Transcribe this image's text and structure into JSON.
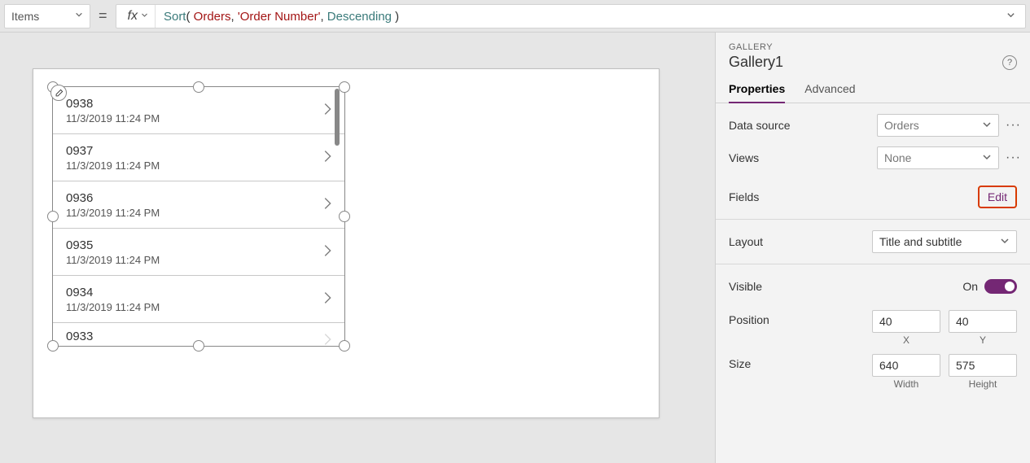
{
  "formulaBar": {
    "property": "Items",
    "fxLabel": "fx",
    "formula": {
      "fn": "Sort",
      "arg1": "Orders",
      "arg2": "'Order Number'",
      "arg3": "Descending"
    }
  },
  "gallery": {
    "items": [
      {
        "title": "0938",
        "subtitle": "11/3/2019 11:24 PM"
      },
      {
        "title": "0937",
        "subtitle": "11/3/2019 11:24 PM"
      },
      {
        "title": "0936",
        "subtitle": "11/3/2019 11:24 PM"
      },
      {
        "title": "0935",
        "subtitle": "11/3/2019 11:24 PM"
      },
      {
        "title": "0934",
        "subtitle": "11/3/2019 11:24 PM"
      },
      {
        "title": "0933",
        "subtitle": ""
      }
    ]
  },
  "panel": {
    "kindLabel": "GALLERY",
    "name": "Gallery1",
    "tabs": {
      "properties": "Properties",
      "advanced": "Advanced"
    },
    "dataSource": {
      "label": "Data source",
      "value": "Orders"
    },
    "views": {
      "label": "Views",
      "value": "None"
    },
    "fields": {
      "label": "Fields",
      "editLabel": "Edit"
    },
    "layout": {
      "label": "Layout",
      "value": "Title and subtitle"
    },
    "visible": {
      "label": "Visible",
      "state": "On"
    },
    "position": {
      "label": "Position",
      "x": "40",
      "y": "40",
      "xLabel": "X",
      "yLabel": "Y"
    },
    "size": {
      "label": "Size",
      "w": "640",
      "h": "575",
      "wLabel": "Width",
      "hLabel": "Height"
    }
  }
}
